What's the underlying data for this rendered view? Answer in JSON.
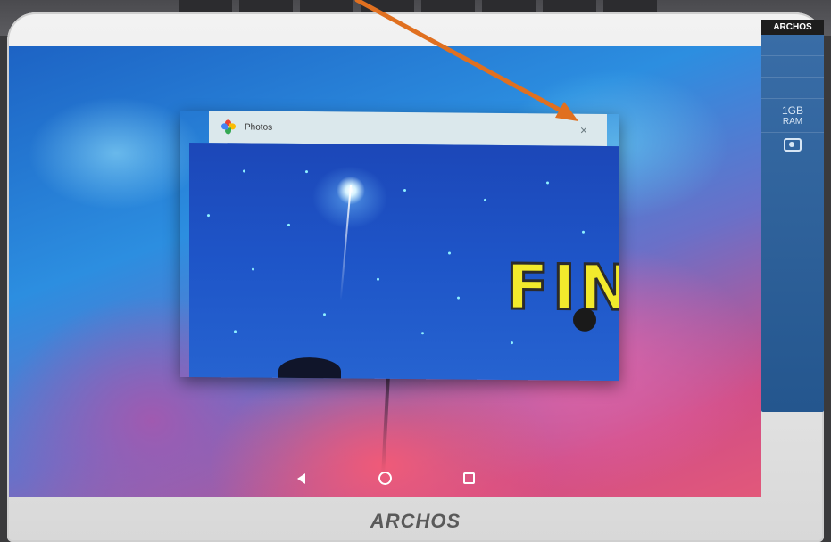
{
  "device": {
    "brand_bottom": "ARCHOS",
    "sticker": {
      "brand": "ARCHOS",
      "specs": [
        "RAM"
      ]
    }
  },
  "popup": {
    "title": "Photos",
    "app_icon": "google-photos-icon",
    "close_icon": "close-icon",
    "close_glyph": "×"
  },
  "photo": {
    "overlay_text": "FIN"
  },
  "navbar": {
    "back_icon": "back-triangle-icon",
    "home_icon": "home-circle-icon",
    "recents_icon": "recents-square-icon"
  },
  "annotation": {
    "color": "#e07020"
  }
}
